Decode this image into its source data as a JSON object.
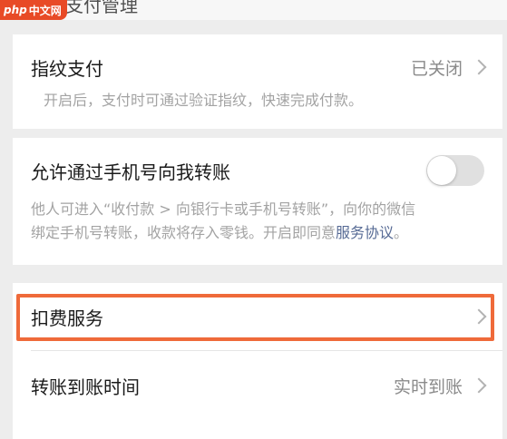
{
  "watermark": {
    "brand": "php",
    "site": "中文网"
  },
  "header": {
    "title": "支付管理"
  },
  "fingerprint": {
    "label": "指纹支付",
    "status": "已关闭",
    "description": "开启后，支付时可通过验证指纹，快速完成付款。"
  },
  "phone_transfer": {
    "label": "允许通过手机号向我转账",
    "enabled": false,
    "description_line1": "他人可进入“收付款 > 向银行卡或手机号转账”，向你的微信",
    "description_line2": "绑定手机号转账，收款将存入零钱。开启即同意",
    "agreement_link": "服务协议",
    "description_end": "。"
  },
  "deduction": {
    "label": "扣费服务"
  },
  "arrival_time": {
    "label": "转账到账时间",
    "value": "实时到账"
  },
  "colors": {
    "highlight": "#ef6a3a",
    "link": "#576b95",
    "background": "#ededed"
  }
}
